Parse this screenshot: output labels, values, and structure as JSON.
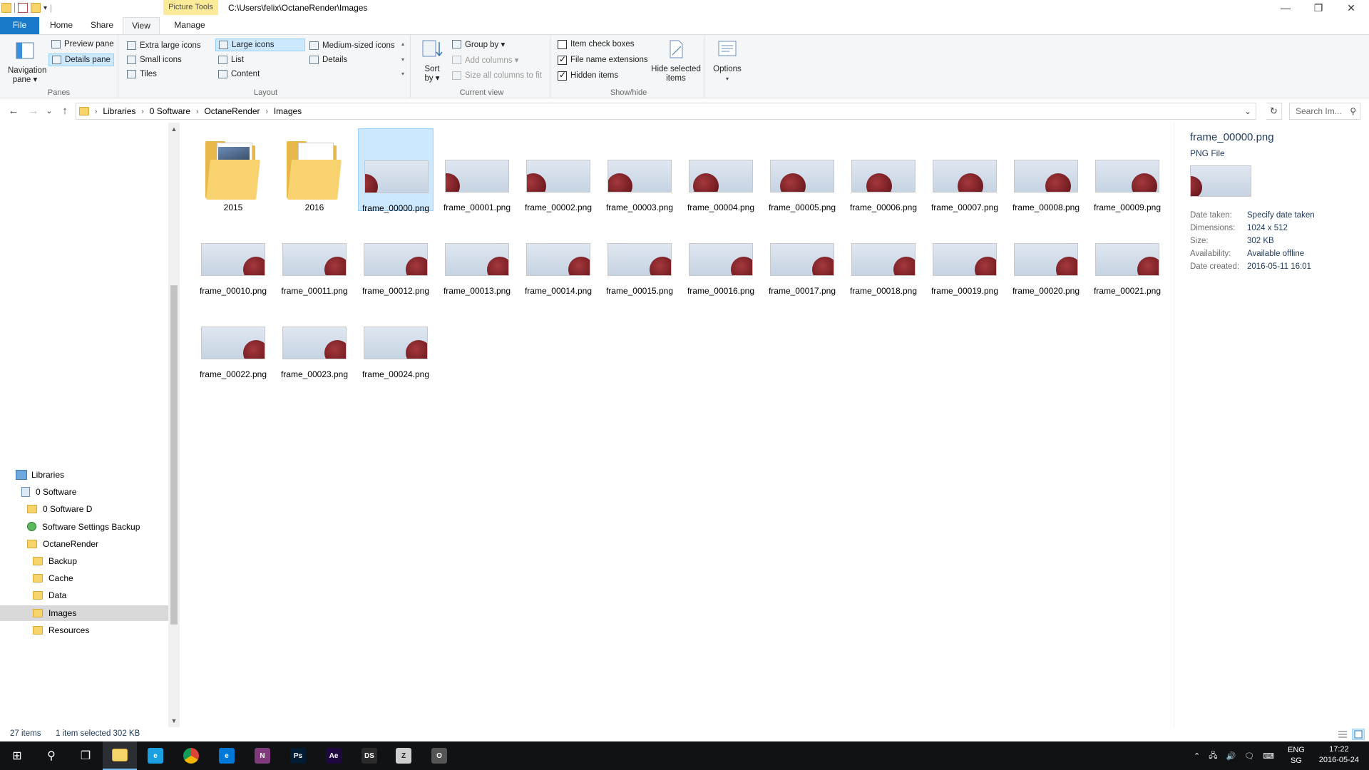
{
  "titlebar": {
    "context_tab": "Picture Tools",
    "path": "C:\\Users\\felix\\OctaneRender\\Images",
    "qat_separator": "|",
    "qat_dropdown": "▾"
  },
  "window_controls": {
    "minimize": "—",
    "maximize": "❐",
    "close": "✕"
  },
  "ribbon_tabs": [
    "File",
    "Home",
    "Share",
    "View",
    "Manage"
  ],
  "help": {
    "collapse": "⌃",
    "help": "?"
  },
  "ribbon": {
    "panes": {
      "label": "Panes",
      "navigation_pane": "Navigation pane ▾",
      "preview_pane": "Preview pane",
      "details_pane": "Details pane"
    },
    "layout": {
      "label": "Layout",
      "items": [
        "Extra large icons",
        "Large icons",
        "Medium-sized icons",
        "Small icons",
        "List",
        "Details",
        "Tiles",
        "Content"
      ],
      "selected": "Large icons"
    },
    "current_view": {
      "label": "Current view",
      "sort_by": "Sort by ▾",
      "group_by": "Group by ▾",
      "add_columns": "Add columns ▾",
      "size_all_columns": "Size all columns to fit"
    },
    "show_hide": {
      "label": "Show/hide",
      "item_check_boxes": "Item check boxes",
      "file_name_extensions": "File name extensions",
      "hidden_items": "Hidden items",
      "hide_selected": "Hide selected items",
      "checks": {
        "item_check_boxes": false,
        "file_name_extensions": true,
        "hidden_items": true
      }
    },
    "options": {
      "label": "Options"
    }
  },
  "address": {
    "breadcrumbs": [
      "Libraries",
      "0 Software",
      "OctaneRender",
      "Images"
    ],
    "search_placeholder": "Search Im...",
    "nav": {
      "back": "←",
      "forward": "→",
      "recent": "⌄",
      "up": "↑",
      "dropdown": "⌄",
      "refresh": "↻",
      "search": "⚲"
    }
  },
  "navpane": {
    "items": [
      {
        "label": "Libraries",
        "type": "library",
        "indent": 0
      },
      {
        "label": "0 Software",
        "type": "doc",
        "indent": 1
      },
      {
        "label": "0 Software D",
        "type": "folder",
        "indent": 2
      },
      {
        "label": "Software Settings Backup",
        "type": "sync",
        "indent": 2
      },
      {
        "label": "OctaneRender",
        "type": "folder",
        "indent": 2
      },
      {
        "label": "Backup",
        "type": "folder",
        "indent": 3
      },
      {
        "label": "Cache",
        "type": "folder",
        "indent": 3
      },
      {
        "label": "Data",
        "type": "folder",
        "indent": 3
      },
      {
        "label": "Images",
        "type": "folder",
        "indent": 3,
        "selected": true
      },
      {
        "label": "Resources",
        "type": "folder",
        "indent": 3
      }
    ],
    "scroll_up": "▲",
    "scroll_down": "▼"
  },
  "files": {
    "folders": [
      "2015",
      "2016"
    ],
    "images": [
      {
        "name": "frame_00000.png",
        "ball": 0.0
      },
      {
        "name": "frame_00001.png",
        "ball": 0.02
      },
      {
        "name": "frame_00002.png",
        "ball": 0.1
      },
      {
        "name": "frame_00003.png",
        "ball": 0.18
      },
      {
        "name": "frame_00004.png",
        "ball": 0.26
      },
      {
        "name": "frame_00005.png",
        "ball": 0.34
      },
      {
        "name": "frame_00006.png",
        "ball": 0.42
      },
      {
        "name": "frame_00007.png",
        "ball": 0.58
      },
      {
        "name": "frame_00008.png",
        "ball": 0.68
      },
      {
        "name": "frame_00009.png",
        "ball": 0.76
      },
      {
        "name": "frame_00010.png",
        "ball": 0.84
      },
      {
        "name": "frame_00011.png",
        "ball": 0.84
      },
      {
        "name": "frame_00012.png",
        "ball": 0.84
      },
      {
        "name": "frame_00013.png",
        "ball": 0.84
      },
      {
        "name": "frame_00014.png",
        "ball": 0.84
      },
      {
        "name": "frame_00015.png",
        "ball": 0.84
      },
      {
        "name": "frame_00016.png",
        "ball": 0.84
      },
      {
        "name": "frame_00017.png",
        "ball": 0.84
      },
      {
        "name": "frame_00018.png",
        "ball": 0.84
      },
      {
        "name": "frame_00019.png",
        "ball": 0.84
      },
      {
        "name": "frame_00020.png",
        "ball": 0.84
      },
      {
        "name": "frame_00021.png",
        "ball": 0.84
      },
      {
        "name": "frame_00022.png",
        "ball": 0.84
      },
      {
        "name": "frame_00023.png",
        "ball": 0.84
      },
      {
        "name": "frame_00024.png",
        "ball": 0.84
      }
    ],
    "selected": "frame_00000.png"
  },
  "details": {
    "title": "frame_00000.png",
    "type": "PNG File",
    "props": [
      {
        "label": "Date taken:",
        "value": "Specify date taken"
      },
      {
        "label": "Dimensions:",
        "value": "1024 x 512"
      },
      {
        "label": "Size:",
        "value": "302 KB"
      },
      {
        "label": "Availability:",
        "value": "Available offline"
      },
      {
        "label": "Date created:",
        "value": "2016-05-11 16:01"
      }
    ]
  },
  "status": {
    "items": "27 items",
    "selected": "1 item selected  302 KB"
  },
  "taskbar": {
    "apps": [
      {
        "name": "start",
        "label": "⊞",
        "color": "#101214"
      },
      {
        "name": "search",
        "label": "⚲",
        "color": "#101214"
      },
      {
        "name": "task-view",
        "label": "❐",
        "color": "#101214"
      },
      {
        "name": "file-explorer",
        "label": "",
        "color": "#f6d46a",
        "active": true
      },
      {
        "name": "internet-explorer",
        "label": "e",
        "color": "#1ba1e2"
      },
      {
        "name": "chrome",
        "label": "",
        "color": "#dd4b39"
      },
      {
        "name": "edge",
        "label": "e",
        "color": "#0078d7"
      },
      {
        "name": "onenote",
        "label": "N",
        "color": "#80397b"
      },
      {
        "name": "photoshop",
        "label": "Ps",
        "color": "#001d34"
      },
      {
        "name": "after-effects",
        "label": "Ae",
        "color": "#1f0740"
      },
      {
        "name": "daz-studio",
        "label": "DS",
        "color": "#2a2a2a"
      },
      {
        "name": "zbrush",
        "label": "Z",
        "color": "#cfcfcf"
      },
      {
        "name": "octane",
        "label": "O",
        "color": "#555"
      }
    ],
    "lang": "ENG",
    "region": "SG",
    "time": "17:22",
    "date": "2016-05-24",
    "tray": {
      "chevron": "⌃",
      "network": "🖧",
      "volume": "🔊",
      "notifications": "🗨",
      "keyboard": "⌨"
    }
  }
}
